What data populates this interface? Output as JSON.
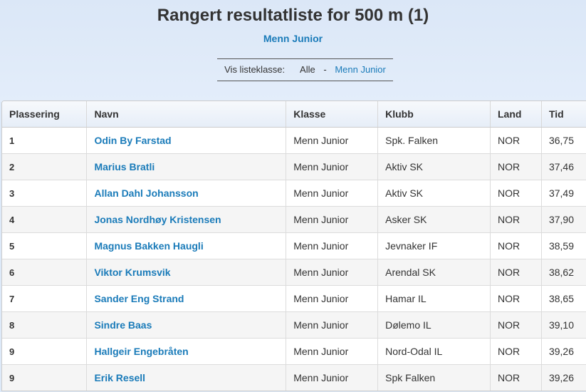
{
  "page": {
    "title": "Rangert resultatliste for 500 m (1)",
    "subtitle": "Menn Junior"
  },
  "filter": {
    "label": "Vis listeklasse:",
    "option_all": "Alle",
    "separator": "-",
    "option_class": "Menn Junior"
  },
  "table": {
    "headers": [
      "Plassering",
      "Navn",
      "Klasse",
      "Klubb",
      "Land",
      "Tid"
    ],
    "rows": [
      {
        "place": "1",
        "name": "Odin By Farstad",
        "class": "Menn Junior",
        "club": "Spk. Falken",
        "country": "NOR",
        "time": "36,75"
      },
      {
        "place": "2",
        "name": "Marius Bratli",
        "class": "Menn Junior",
        "club": "Aktiv SK",
        "country": "NOR",
        "time": "37,46"
      },
      {
        "place": "3",
        "name": "Allan Dahl Johansson",
        "class": "Menn Junior",
        "club": "Aktiv SK",
        "country": "NOR",
        "time": "37,49"
      },
      {
        "place": "4",
        "name": "Jonas Nordhøy Kristensen",
        "class": "Menn Junior",
        "club": "Asker SK",
        "country": "NOR",
        "time": "37,90"
      },
      {
        "place": "5",
        "name": "Magnus Bakken Haugli",
        "class": "Menn Junior",
        "club": "Jevnaker IF",
        "country": "NOR",
        "time": "38,59"
      },
      {
        "place": "6",
        "name": "Viktor Krumsvik",
        "class": "Menn Junior",
        "club": "Arendal SK",
        "country": "NOR",
        "time": "38,62"
      },
      {
        "place": "7",
        "name": "Sander Eng Strand",
        "class": "Menn Junior",
        "club": "Hamar IL",
        "country": "NOR",
        "time": "38,65"
      },
      {
        "place": "8",
        "name": "Sindre Baas",
        "class": "Menn Junior",
        "club": "Dølemo IL",
        "country": "NOR",
        "time": "39,10"
      },
      {
        "place": "9",
        "name": "Hallgeir Engebråten",
        "class": "Menn Junior",
        "club": "Nord-Odal IL",
        "country": "NOR",
        "time": "39,26"
      },
      {
        "place": "9",
        "name": "Erik Resell",
        "class": "Menn Junior",
        "club": "Spk Falken",
        "country": "NOR",
        "time": "39,26"
      }
    ]
  }
}
